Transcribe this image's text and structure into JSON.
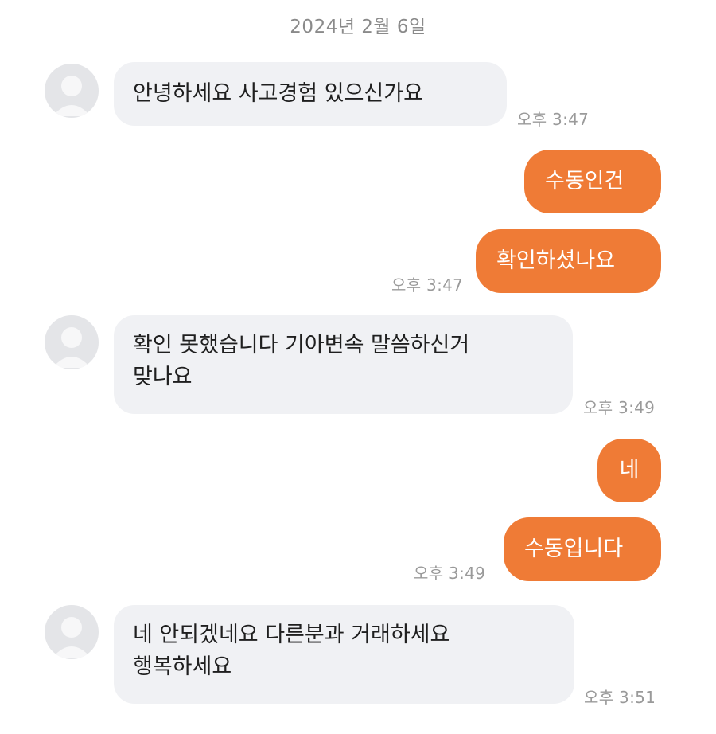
{
  "chat": {
    "date": "2024년 2월 6일",
    "messages": [
      {
        "side": "in",
        "text": "안녕하세요  사고경험 있으신가요",
        "time": "오후 3:47"
      },
      {
        "side": "out",
        "text": "수동인건"
      },
      {
        "side": "out",
        "text": "확인하셨나요",
        "time": "오후 3:47"
      },
      {
        "side": "in",
        "text": "확인 못했습니다  기아변속 말씀하신거\n맞나요",
        "time": "오후 3:49"
      },
      {
        "side": "out",
        "text": "네"
      },
      {
        "side": "out",
        "text": "수동입니다",
        "time": "오후 3:49"
      },
      {
        "side": "in",
        "text": "네  안되겠네요   다른분과  거래하세요\n행복하세요",
        "time": "오후 3:51"
      }
    ]
  },
  "icons": {
    "avatar": "default-profile-avatar-icon"
  },
  "colors": {
    "outgoing_bubble": "#ef7b36",
    "incoming_bubble": "#f0f1f4",
    "timestamp": "#9a9a9a"
  }
}
